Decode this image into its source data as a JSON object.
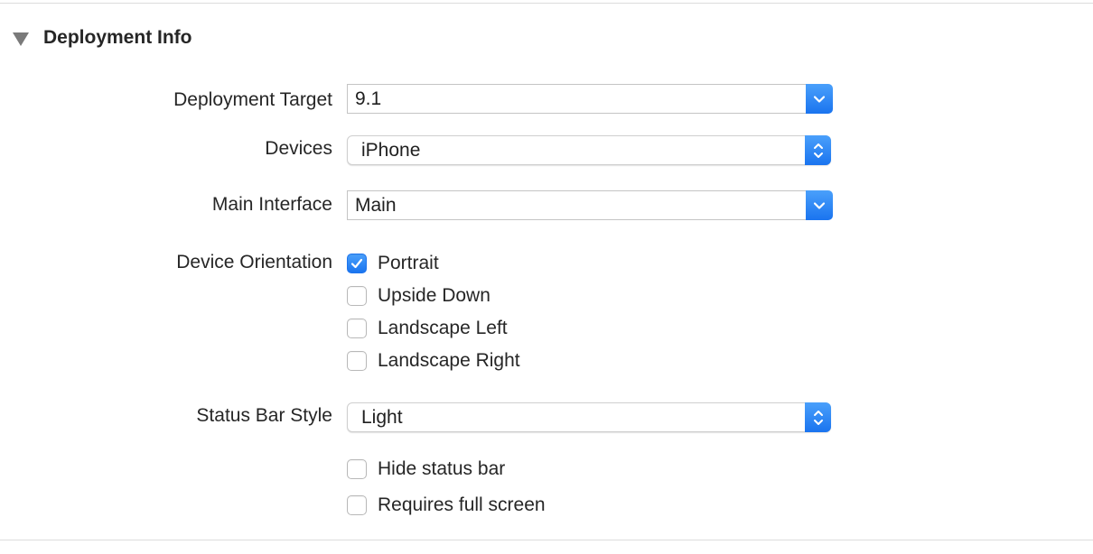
{
  "section": {
    "title": "Deployment Info"
  },
  "deployment_target": {
    "label": "Deployment Target",
    "value": "9.1"
  },
  "devices": {
    "label": "Devices",
    "value": "iPhone"
  },
  "main_interface": {
    "label": "Main Interface",
    "value": "Main"
  },
  "device_orientation": {
    "label": "Device Orientation",
    "options": [
      {
        "label": "Portrait",
        "checked": true
      },
      {
        "label": "Upside Down",
        "checked": false
      },
      {
        "label": "Landscape Left",
        "checked": false
      },
      {
        "label": "Landscape Right",
        "checked": false
      }
    ]
  },
  "status_bar_style": {
    "label": "Status Bar Style",
    "value": "Light"
  },
  "options": [
    {
      "label": "Hide status bar",
      "checked": false
    },
    {
      "label": "Requires full screen",
      "checked": false
    }
  ],
  "colors": {
    "accent": "#1a74ef"
  }
}
